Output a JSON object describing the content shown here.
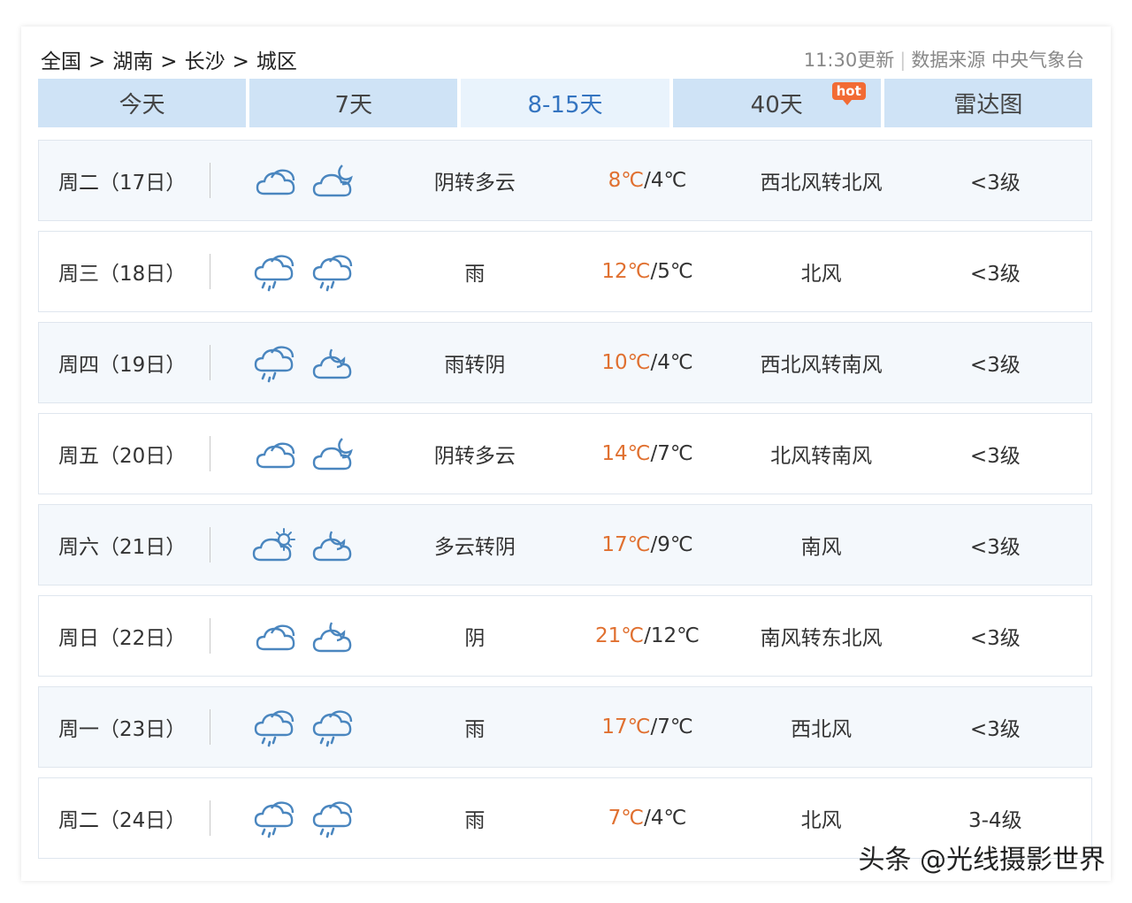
{
  "breadcrumb": [
    "全国",
    "湖南",
    "长沙",
    "城区"
  ],
  "breadcrumb_sep": ">",
  "update_time": "11:30更新",
  "data_source": "数据来源 中央气象台",
  "tabs": [
    {
      "label": "今天"
    },
    {
      "label": "7天"
    },
    {
      "label": "8-15天"
    },
    {
      "label": "40天",
      "badge": "hot"
    },
    {
      "label": "雷达图"
    }
  ],
  "active_tab": "8-15天",
  "days": [
    {
      "day": "周二（17日）",
      "icon_day": "cloudy-icon",
      "icon_night": "cloudy-night-icon",
      "weather": "阴转多云",
      "high": "8℃",
      "low": "/4℃",
      "wind": "西北风转北风",
      "level": "<3级"
    },
    {
      "day": "周三（18日）",
      "icon_day": "rain-icon",
      "icon_night": "rain-icon",
      "weather": "雨",
      "high": "12℃",
      "low": "/5℃",
      "wind": "北风",
      "level": "<3级"
    },
    {
      "day": "周四（19日）",
      "icon_day": "rain-icon",
      "icon_night": "overcast-night-icon",
      "weather": "雨转阴",
      "high": "10℃",
      "low": "/4℃",
      "wind": "西北风转南风",
      "level": "<3级"
    },
    {
      "day": "周五（20日）",
      "icon_day": "cloudy-icon",
      "icon_night": "cloudy-night-icon",
      "weather": "阴转多云",
      "high": "14℃",
      "low": "/7℃",
      "wind": "北风转南风",
      "level": "<3级"
    },
    {
      "day": "周六（21日）",
      "icon_day": "partly-sunny-icon",
      "icon_night": "overcast-night-icon",
      "weather": "多云转阴",
      "high": "17℃",
      "low": "/9℃",
      "wind": "南风",
      "level": "<3级"
    },
    {
      "day": "周日（22日）",
      "icon_day": "cloudy-icon",
      "icon_night": "overcast-night-icon",
      "weather": "阴",
      "high": "21℃",
      "low": "/12℃",
      "wind": "南风转东北风",
      "level": "<3级"
    },
    {
      "day": "周一（23日）",
      "icon_day": "rain-icon",
      "icon_night": "rain-icon",
      "weather": "雨",
      "high": "17℃",
      "low": "/7℃",
      "wind": "西北风",
      "level": "<3级"
    },
    {
      "day": "周二（24日）",
      "icon_day": "rain-icon",
      "icon_night": "rain-icon",
      "weather": "雨",
      "high": "7℃",
      "low": "/4℃",
      "wind": "北风",
      "level": "3-4级"
    }
  ],
  "watermark": "头条 @光线摄影世界",
  "colors": {
    "tab_bg": "#cfe3f6",
    "tab_active_bg": "#e9f3fc",
    "tab_active_text": "#3474c0",
    "high_temp": "#e07030",
    "hot_badge": "#f26b34",
    "icon_stroke": "#4a86bf"
  }
}
